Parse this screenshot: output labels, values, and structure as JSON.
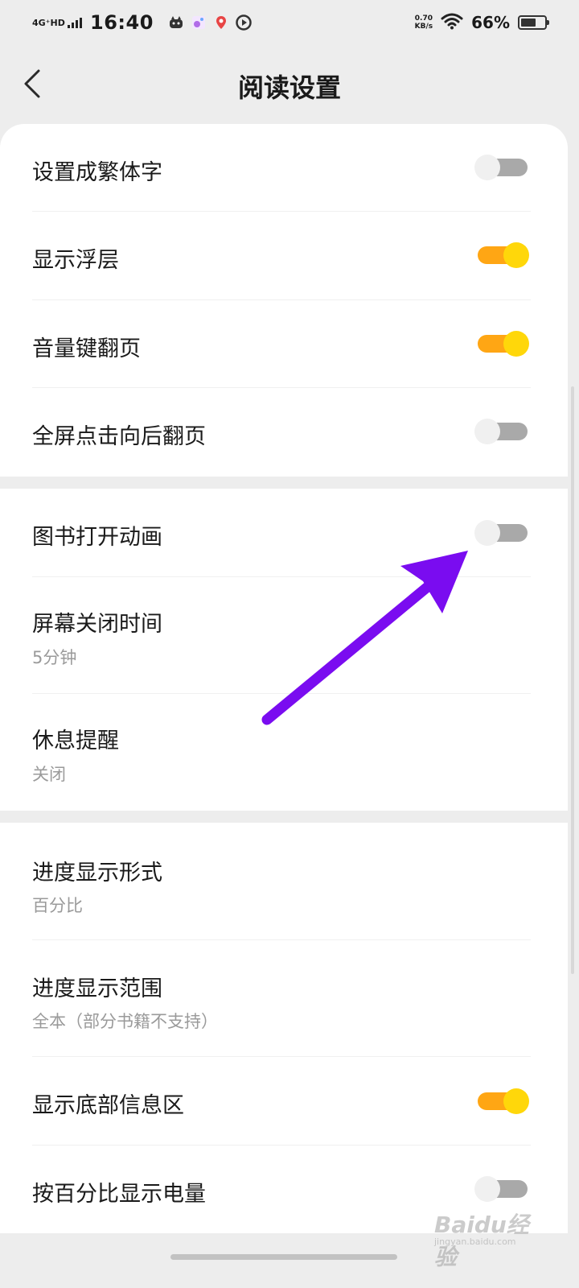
{
  "status_bar": {
    "network": "4G⁺HD",
    "time": "16:40",
    "speed_value": "0.70",
    "speed_unit": "KB/s",
    "battery_pct": "66%",
    "battery_level": 0.66
  },
  "header": {
    "title": "阅读设置"
  },
  "sections": [
    {
      "items": [
        {
          "title": "设置成繁体字",
          "toggle": false
        },
        {
          "title": "显示浮层",
          "toggle": true
        },
        {
          "title": "音量键翻页",
          "toggle": true
        },
        {
          "title": "全屏点击向后翻页",
          "toggle": false
        }
      ]
    },
    {
      "items": [
        {
          "title": "图书打开动画",
          "toggle": false
        },
        {
          "title": "屏幕关闭时间",
          "subtitle": "5分钟"
        },
        {
          "title": "休息提醒",
          "subtitle": "关闭"
        }
      ]
    },
    {
      "items": [
        {
          "title": "进度显示形式",
          "subtitle": "百分比"
        },
        {
          "title": "进度显示范围",
          "subtitle": "全本（部分书籍不支持）"
        },
        {
          "title": "显示底部信息区",
          "toggle": true
        },
        {
          "title": "按百分比显示电量",
          "toggle": false
        }
      ]
    }
  ],
  "annotation": {
    "arrow_color": "#7a0cf0"
  },
  "watermark": {
    "main": "Baidu经验",
    "sub": "jingyan.baidu.com"
  },
  "colors": {
    "toggle_on_track": "#ffa614",
    "toggle_on_knob": "#ffd70a",
    "toggle_off_track": "#a9a9a9",
    "background": "#ededed"
  }
}
